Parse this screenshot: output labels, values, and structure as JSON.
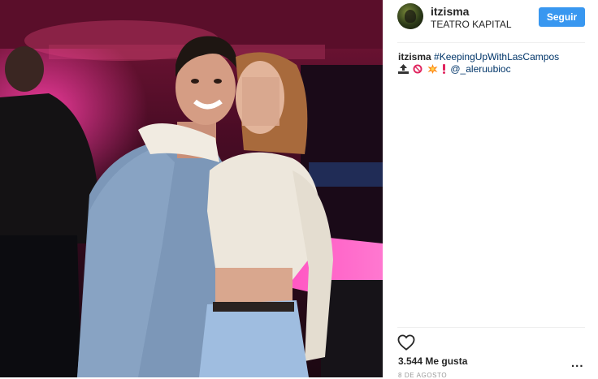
{
  "post": {
    "username": "itzisma",
    "location": "TEATRO KAPITAL",
    "follow_label": "Seguir",
    "caption": {
      "username": "itzisma",
      "hashtag": "#KeepingUpWithLasCampos",
      "emoji_icons": [
        "top-icon",
        "no-under-18-icon",
        "collision-icon",
        "exclamation-icon"
      ],
      "mention": "@_aleruubioc"
    },
    "likes": "3.544 Me gusta",
    "more_label": "...",
    "date": "8 DE AGOSTO"
  },
  "colors": {
    "accent": "#3897f0",
    "text": "#262626",
    "link": "#003569",
    "muted": "#999999",
    "divider": "#efefef"
  },
  "photo": {
    "content": "photo"
  }
}
